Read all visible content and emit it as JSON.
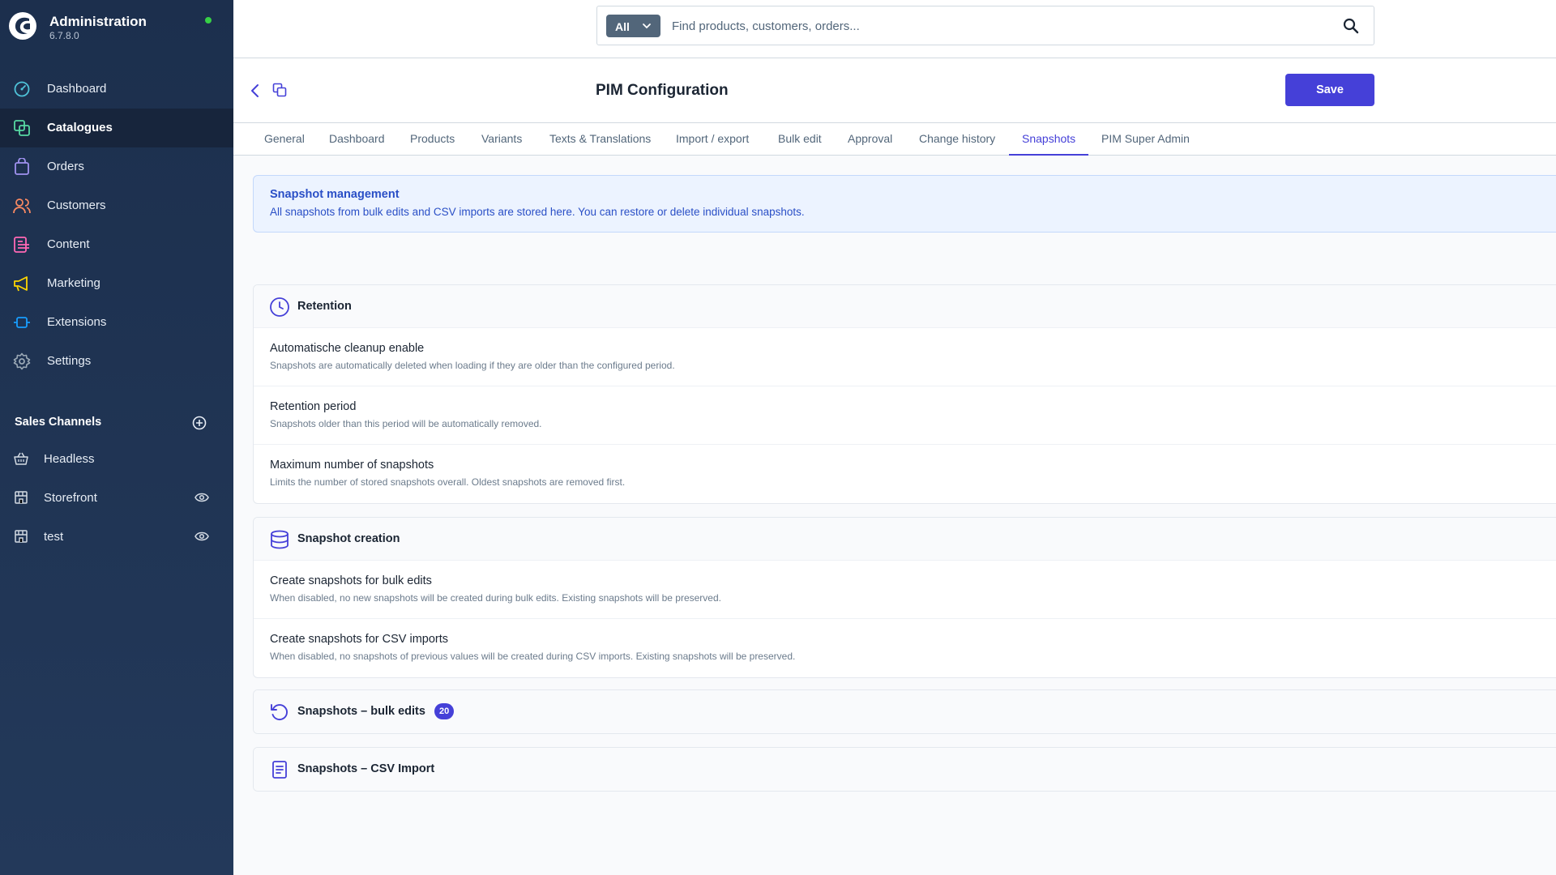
{
  "sidebar": {
    "brand": {
      "title": "Administration",
      "version": "6.7.8.0"
    },
    "items": [
      {
        "label": "Dashboard",
        "icon": "dashboard-icon",
        "color": "#4fc3d9"
      },
      {
        "label": "Catalogues",
        "icon": "catalogues-icon",
        "color": "#57d9a3",
        "active": true
      },
      {
        "label": "Orders",
        "icon": "orders-icon",
        "color": "#a092f0"
      },
      {
        "label": "Customers",
        "icon": "customers-icon",
        "color": "#f88962"
      },
      {
        "label": "Content",
        "icon": "content-icon",
        "color": "#ff68b4"
      },
      {
        "label": "Marketing",
        "icon": "marketing-icon",
        "color": "#ffd700"
      },
      {
        "label": "Extensions",
        "icon": "extensions-icon",
        "color": "#189eff"
      },
      {
        "label": "Settings",
        "icon": "settings-icon",
        "color": "#9aa8b5"
      }
    ],
    "sales_channels": {
      "title": "Sales Channels",
      "items": [
        {
          "label": "Headless",
          "icon": "basket-icon"
        },
        {
          "label": "Storefront",
          "icon": "storefront-icon"
        },
        {
          "label": "test",
          "icon": "storefront-icon"
        }
      ]
    }
  },
  "search": {
    "type_label": "All",
    "placeholder": "Find products, customers, orders..."
  },
  "smartbar": {
    "title": "PIM Configuration",
    "save_label": "Save"
  },
  "tabs": [
    {
      "label": "General"
    },
    {
      "label": "Dashboard"
    },
    {
      "label": "Products"
    },
    {
      "label": "Variants"
    },
    {
      "label": "Texts & Translations"
    },
    {
      "label": "Import / export"
    },
    {
      "label": "Bulk edit"
    },
    {
      "label": "Approval"
    },
    {
      "label": "Change history"
    },
    {
      "label": "Snapshots",
      "active": true
    },
    {
      "label": "PIM Super Admin"
    }
  ],
  "alert": {
    "title": "Snapshot management",
    "text": "All snapshots from bulk edits and CSV imports are stored here. You can restore or delete individual snapshots."
  },
  "retention": {
    "title": "Retention",
    "rows": [
      {
        "title": "Automatische cleanup enable",
        "desc": "Snapshots are automatically deleted when loading if they are older than the configured period."
      },
      {
        "title": "Retention period",
        "desc": "Snapshots older than this period will be automatically removed."
      },
      {
        "title": "Maximum number of snapshots",
        "desc": "Limits the number of stored snapshots overall. Oldest snapshots are removed first."
      }
    ]
  },
  "creation": {
    "title": "Snapshot creation",
    "rows": [
      {
        "title": "Create snapshots for bulk edits",
        "desc": "When disabled, no new snapshots will be created during bulk edits. Existing snapshots will be preserved."
      },
      {
        "title": "Create snapshots for CSV imports",
        "desc": "When disabled, no snapshots of previous values will be created during CSV imports. Existing snapshots will be preserved."
      }
    ]
  },
  "bulk_edits": {
    "title": "Snapshots – bulk edits",
    "count": "20"
  },
  "csv_import": {
    "title": "Snapshots – CSV Import"
  },
  "colors": {
    "accent": "#4540d8",
    "sidebar": "#1c2f4d",
    "status_online": "#37d046"
  }
}
